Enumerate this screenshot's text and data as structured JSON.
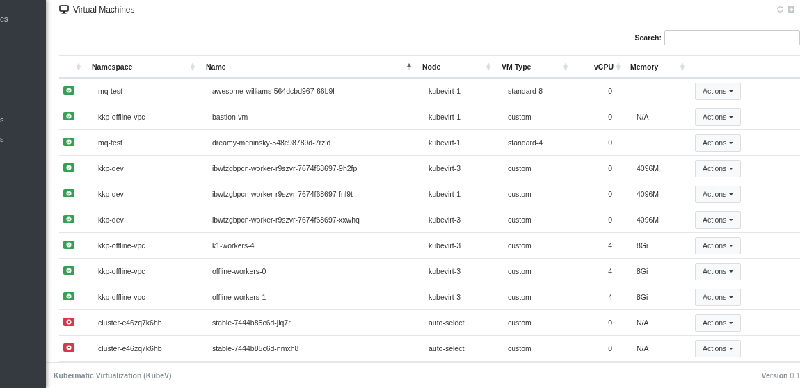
{
  "sidebar": {
    "items": [
      "es",
      "s",
      "s"
    ]
  },
  "page": {
    "title": "Virtual Machines"
  },
  "search": {
    "label": "Search:"
  },
  "table": {
    "columns": [
      {
        "sorted": false
      },
      {
        "label": "Namespace",
        "sorted": false
      },
      {
        "label": "Name",
        "sorted": true
      },
      {
        "label": "Node",
        "sorted": false
      },
      {
        "label": "VM Type",
        "sorted": false
      },
      {
        "label": "vCPU",
        "sorted": false
      },
      {
        "label": "Memory",
        "sorted": false
      }
    ],
    "rows": [
      {
        "running": true,
        "namespace": "mq-test",
        "name": "awesome-williams-564dcbd967-66b9l",
        "node": "kubevirt-1",
        "vm_type": "standard-8",
        "vcpu": "0",
        "action": "Actions"
      },
      {
        "running": true,
        "namespace": "kkp-offline-vpc",
        "name": "bastion-vm",
        "node": "kubevirt-1",
        "vm_type": "custom",
        "vcpu": "0",
        "memory": "N/A",
        "action": "Actions"
      },
      {
        "running": true,
        "namespace": "mq-test",
        "name": "dreamy-meninsky-548c98789d-7rzld",
        "node": "kubevirt-1",
        "vm_type": "standard-4",
        "vcpu": "0",
        "action": "Actions"
      },
      {
        "running": true,
        "namespace": "kkp-dev",
        "name": "ibwtzgbpcn-worker-r9szvr-7674f68697-9h2fp",
        "node": "kubevirt-3",
        "vm_type": "custom",
        "vcpu": "0",
        "memory": "4096M",
        "action": "Actions"
      },
      {
        "running": true,
        "namespace": "kkp-dev",
        "name": "ibwtzgbpcn-worker-r9szvr-7674f68697-fnl9t",
        "node": "kubevirt-1",
        "vm_type": "custom",
        "vcpu": "0",
        "memory": "4096M",
        "action": "Actions"
      },
      {
        "running": true,
        "namespace": "kkp-dev",
        "name": "ibwtzgbpcn-worker-r9szvr-7674f68697-xxwhq",
        "node": "kubevirt-3",
        "vm_type": "custom",
        "vcpu": "0",
        "memory": "4096M",
        "action": "Actions"
      },
      {
        "running": true,
        "namespace": "kkp-offline-vpc",
        "name": "k1-workers-4",
        "node": "kubevirt-3",
        "vm_type": "custom",
        "vcpu": "4",
        "memory": "8Gi",
        "action": "Actions"
      },
      {
        "running": true,
        "namespace": "kkp-offline-vpc",
        "name": "offline-workers-0",
        "node": "kubevirt-3",
        "vm_type": "custom",
        "vcpu": "4",
        "memory": "8Gi",
        "action": "Actions"
      },
      {
        "running": true,
        "namespace": "kkp-offline-vpc",
        "name": "offline-workers-1",
        "node": "kubevirt-3",
        "vm_type": "custom",
        "vcpu": "4",
        "memory": "8Gi",
        "action": "Actions"
      },
      {
        "running": false,
        "namespace": "cluster-e46zq7k6hb",
        "name": "stable-7444b85c6d-jlq7r",
        "node": "auto-select",
        "vm_type": "custom",
        "vcpu": "0",
        "memory": "N/A",
        "action": "Actions"
      },
      {
        "running": false,
        "namespace": "cluster-e46zq7k6hb",
        "name": "stable-7444b85c6d-nmxh8",
        "node": "auto-select",
        "vm_type": "custom",
        "vcpu": "0",
        "memory": "N/A",
        "action": "Actions"
      }
    ]
  },
  "footer": {
    "product": "Kubermatic Virtualization (KubeV)",
    "version_label": "Version",
    "version": "0.1"
  }
}
